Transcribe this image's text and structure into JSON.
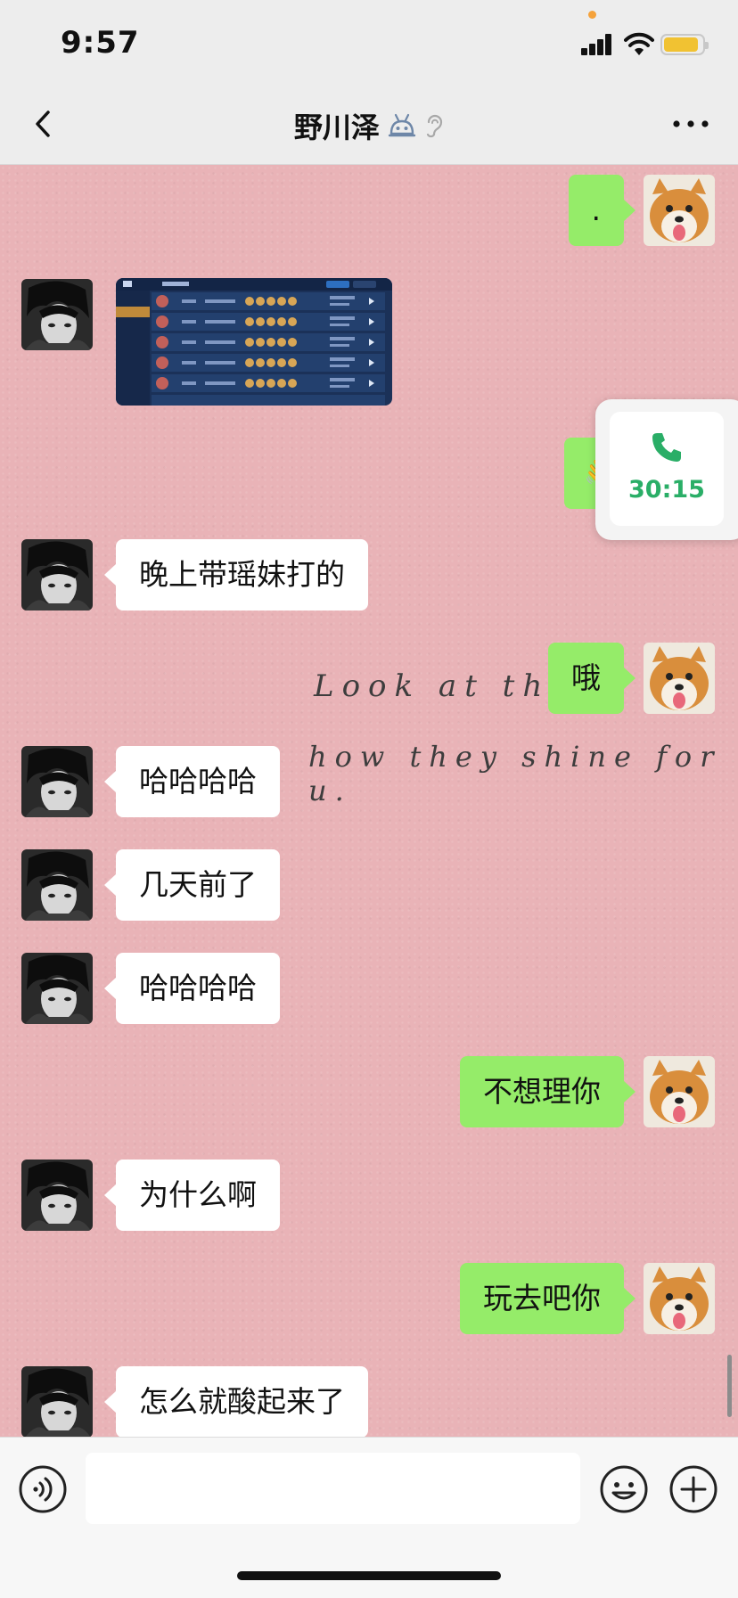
{
  "status_bar": {
    "time": "9:57"
  },
  "header": {
    "title": "野川泽"
  },
  "messages": [
    {
      "side": "right",
      "type": "text",
      "text": "."
    },
    {
      "side": "left",
      "type": "image",
      "alt": "历史战绩"
    },
    {
      "side": "right",
      "type": "text",
      "text": "👋"
    },
    {
      "side": "left",
      "type": "text",
      "text": "晚上带瑶妹打的"
    },
    {
      "side": "right",
      "type": "text",
      "text": "哦"
    },
    {
      "side": "left",
      "type": "text",
      "text": "哈哈哈哈"
    },
    {
      "side": "left",
      "type": "text",
      "text": "几天前了"
    },
    {
      "side": "left",
      "type": "text",
      "text": "哈哈哈哈"
    },
    {
      "side": "right",
      "type": "text",
      "text": "不想理你"
    },
    {
      "side": "left",
      "type": "text",
      "text": "为什么啊"
    },
    {
      "side": "right",
      "type": "text",
      "text": "玩去吧你"
    },
    {
      "side": "left",
      "type": "text",
      "text": "怎么就酸起来了"
    }
  ],
  "background_text": {
    "line1": "Look at the s",
    "line2": "how they shine for u."
  },
  "call_float": {
    "duration": "30:15"
  },
  "input_bar": {
    "placeholder": ""
  },
  "colors": {
    "bubble_green": "#95ec69",
    "bubble_white": "#ffffff",
    "call_green": "#2aae67",
    "chat_bg": "#e9b3b7"
  },
  "icons": [
    "back-icon",
    "robot-icon",
    "ear-icon",
    "more-icon",
    "phone-icon",
    "voice-icon",
    "emoji-icon",
    "plus-icon"
  ]
}
